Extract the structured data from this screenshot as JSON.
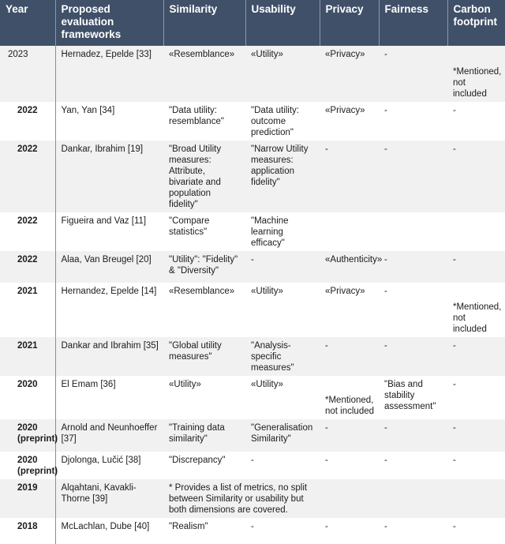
{
  "table": {
    "columns": [
      {
        "key": "year",
        "label": "Year"
      },
      {
        "key": "framework",
        "label": "Proposed evaluation frameworks"
      },
      {
        "key": "similarity",
        "label": "Similarity"
      },
      {
        "key": "usability",
        "label": "Usability"
      },
      {
        "key": "privacy",
        "label": "Privacy"
      },
      {
        "key": "fairness",
        "label": "Fairness"
      },
      {
        "key": "carbon",
        "label": "Carbon footprint"
      }
    ],
    "dash": "-",
    "mentioned_note": "*Mentioned, not included",
    "rows": [
      {
        "year": "2023",
        "framework": "Hernadez, Epelde [33]",
        "similarity": "«Resemblance»",
        "usability": "«Utility»",
        "privacy": "«Privacy»",
        "fairness": "-",
        "carbon": "*Mentioned, not included"
      },
      {
        "year": "2022",
        "framework": "Yan, Yan [34]",
        "similarity": "\"Data utility: resemblance\"",
        "usability": "\"Data utility: outcome prediction\"",
        "privacy": "«Privacy»",
        "fairness": "-",
        "carbon": "-"
      },
      {
        "year": "2022",
        "framework": "Dankar, Ibrahim [19]",
        "similarity": "\"Broad Utility measures: Attribute, bivariate and population fidelity\"",
        "usability": "\"Narrow Utility measures: application fidelity\"",
        "privacy": "-",
        "fairness": "-",
        "carbon": "-"
      },
      {
        "year": "2022",
        "framework": "Figueira and Vaz [11]",
        "similarity": "\"Compare statistics\"",
        "usability": "\"Machine learning efficacy\"",
        "privacy": "",
        "fairness": "",
        "carbon": ""
      },
      {
        "year": "2022",
        "framework": "Alaa, Van Breugel [20]",
        "similarity": "\"Utility\": \"Fidelity\" & \"Diversity\"",
        "usability": "-",
        "privacy": "«Authenticity»",
        "fairness": "-",
        "carbon": "-"
      },
      {
        "year": "2021",
        "framework": "Hernandez, Epelde [14]",
        "similarity": "«Resemblance»",
        "usability": "«Utility»",
        "privacy": "«Privacy»",
        "fairness": "-",
        "carbon": "*Mentioned, not included"
      },
      {
        "year": "2021",
        "framework": "Dankar and Ibrahim [35]",
        "similarity": "\"Global utility measures\"",
        "usability": "\"Analysis-specific measures\"",
        "privacy": "-",
        "fairness": "-",
        "carbon": "-"
      },
      {
        "year": "2020",
        "framework": "El Emam [36]",
        "similarity": "«Utility»",
        "usability": "«Utility»",
        "privacy": "*Mentioned, not included",
        "fairness": "\"Bias and stability assessment\"",
        "carbon": "-"
      },
      {
        "year": "2020 (preprint)",
        "framework": "Arnold and Neunhoeffer [37]",
        "similarity": "\"Training data similarity\"",
        "usability": "\"Generalisation Similarity\"",
        "privacy": "-",
        "fairness": "-",
        "carbon": "-"
      },
      {
        "year": "2020 (preprint)",
        "framework": "Djolonga, Lučić [38]",
        "similarity": "\"Discrepancy\"",
        "usability": "-",
        "privacy": "-",
        "fairness": "-",
        "carbon": "-"
      },
      {
        "year": "2019",
        "framework": "Alqahtani, Kavakli-Thorne [39]",
        "similarity_usability_span": "* Provides a list of metrics, no split between Similarity or usability but both dimensions are covered.",
        "privacy": "",
        "fairness": "",
        "carbon": ""
      },
      {
        "year": "2018",
        "framework": "McLachlan, Dube [40]",
        "similarity": "\"Realism\"",
        "usability": "-",
        "privacy": "-",
        "fairness": "-",
        "carbon": "-"
      }
    ]
  },
  "colors": {
    "header_bg": "#3f5068",
    "header_text": "#ffffff",
    "row_alt_bg": "#f1f1f1",
    "row_bg": "#ffffff",
    "text": "#1c1c1c"
  }
}
